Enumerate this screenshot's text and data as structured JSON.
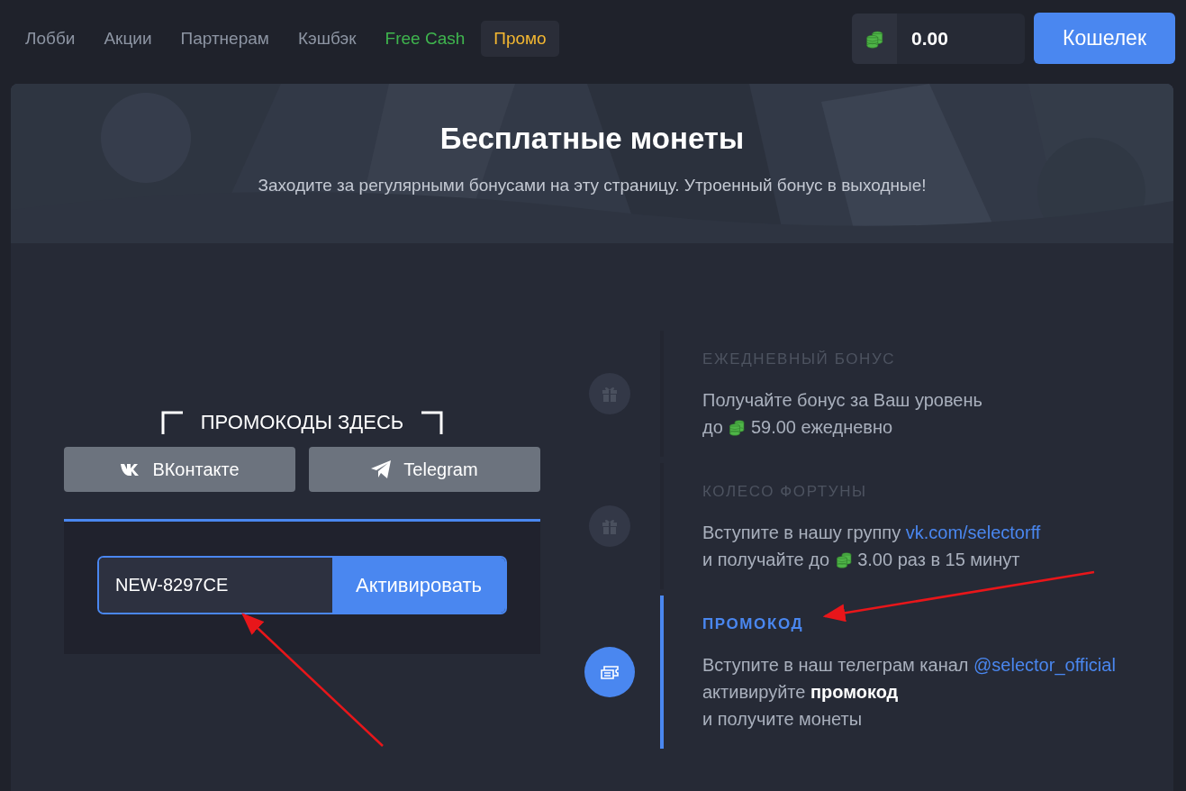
{
  "nav": {
    "tabs": [
      {
        "label": "Лобби",
        "selected": false,
        "color": "#8d95a3"
      },
      {
        "label": "Акции",
        "selected": false,
        "color": "#8d95a3"
      },
      {
        "label": "Партнерам",
        "selected": false,
        "color": "#8d95a3"
      },
      {
        "label": "Кэшбэк",
        "selected": false,
        "color": "#8d95a3"
      },
      {
        "label": "Free Cash",
        "selected": false,
        "color": "#3fb54e"
      },
      {
        "label": "Промо",
        "selected": true,
        "color": "#f3b731"
      }
    ],
    "balance": "0.00",
    "wallet_button": "Кошелек"
  },
  "hero": {
    "title": "Бесплатные монеты",
    "subtitle": "Заходите за регулярными бонусами на эту страницу. Утроенный бонус в выходные!"
  },
  "promo_panel": {
    "heading": "ПРОМОКОДЫ ЗДЕСЬ",
    "social_buttons": [
      {
        "label": "ВКонтакте",
        "kind": "vk"
      },
      {
        "label": "Telegram",
        "kind": "telegram"
      }
    ],
    "code_field": {
      "value": "NEW-8297CE"
    },
    "activate_button": "Активировать"
  },
  "timeline": [
    {
      "title": "ЕЖЕДНЕВНЫЙ БОНУС",
      "selected": false,
      "lines": [
        [
          {
            "kind": "text",
            "text": "Получайте бонус за Ваш уровень"
          }
        ],
        [
          {
            "kind": "text",
            "text": "до"
          },
          {
            "kind": "coin"
          },
          {
            "kind": "text",
            "text": "59.00  ежедневно"
          }
        ]
      ]
    },
    {
      "title": "КОЛЕСО ФОРТУНЫ",
      "selected": false,
      "lines": [
        [
          {
            "kind": "text",
            "text": "Вступите в нашу группу"
          },
          {
            "kind": "link",
            "text": "vk.com/selectorff"
          }
        ],
        [
          {
            "kind": "text",
            "text": "и получайте до "
          },
          {
            "kind": "coin"
          },
          {
            "kind": "text",
            "text": "3.00  раз в 15 минут"
          }
        ]
      ]
    },
    {
      "title": "ПРОМОКОД",
      "selected": true,
      "lines": [
        [
          {
            "kind": "text",
            "text": "Вступите в наш телеграм канал"
          },
          {
            "kind": "link",
            "text": "@selector_official"
          }
        ],
        [
          {
            "kind": "text",
            "text": "активируйте"
          },
          {
            "kind": "bold",
            "text": "промокод"
          }
        ],
        [
          {
            "kind": "text",
            "text": "и получите монеты"
          }
        ]
      ]
    }
  ]
}
